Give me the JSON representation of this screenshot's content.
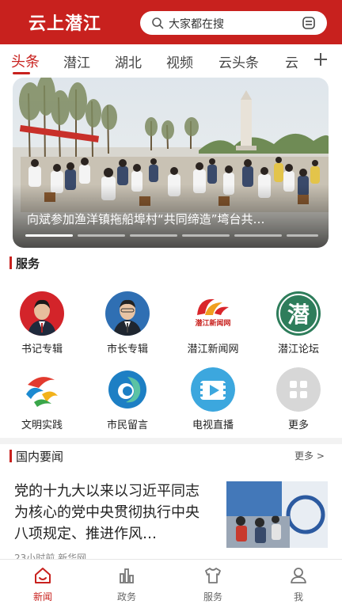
{
  "header": {
    "logo": "云上潜江",
    "search_placeholder": "大家都在搜",
    "brand_color": "#c8211e"
  },
  "tabs": [
    {
      "label": "头条",
      "active": true
    },
    {
      "label": "潜江",
      "active": false
    },
    {
      "label": "湖北",
      "active": false
    },
    {
      "label": "视频",
      "active": false
    },
    {
      "label": "云头条",
      "active": false
    },
    {
      "label": "云",
      "active": false
    }
  ],
  "banner": {
    "caption": "向斌参加渔洋镇拖船埠村“共同缔造”塆台共…"
  },
  "services": {
    "title": "服务",
    "items": [
      {
        "label": "书记专辑",
        "icon": "portrait-icon"
      },
      {
        "label": "市长专辑",
        "icon": "portrait-icon"
      },
      {
        "label": "潜江新闻网",
        "icon": "news-site-logo-icon",
        "logo_text": "潜江新闻网"
      },
      {
        "label": "潜江论坛",
        "icon": "forum-logo-icon",
        "logo_text": "潜"
      },
      {
        "label": "文明实践",
        "icon": "civilization-logo-icon"
      },
      {
        "label": "市民留言",
        "icon": "message-logo-icon"
      },
      {
        "label": "电视直播",
        "icon": "tv-live-icon"
      },
      {
        "label": "更多",
        "icon": "grid-more-icon"
      }
    ]
  },
  "domestic": {
    "title": "国内要闻",
    "more": "更多 >",
    "article": {
      "title": "党的十九大以来以习近平同志为核心的党中央贯彻执行中央八项规定、推进作风…",
      "meta": "23小时前 新华网"
    }
  },
  "bottom_nav": [
    {
      "label": "新闻",
      "icon": "home-icon",
      "active": true
    },
    {
      "label": "政务",
      "icon": "bar-chart-icon",
      "active": false
    },
    {
      "label": "服务",
      "icon": "shirt-icon",
      "active": false
    },
    {
      "label": "我",
      "icon": "user-icon",
      "active": false
    }
  ]
}
